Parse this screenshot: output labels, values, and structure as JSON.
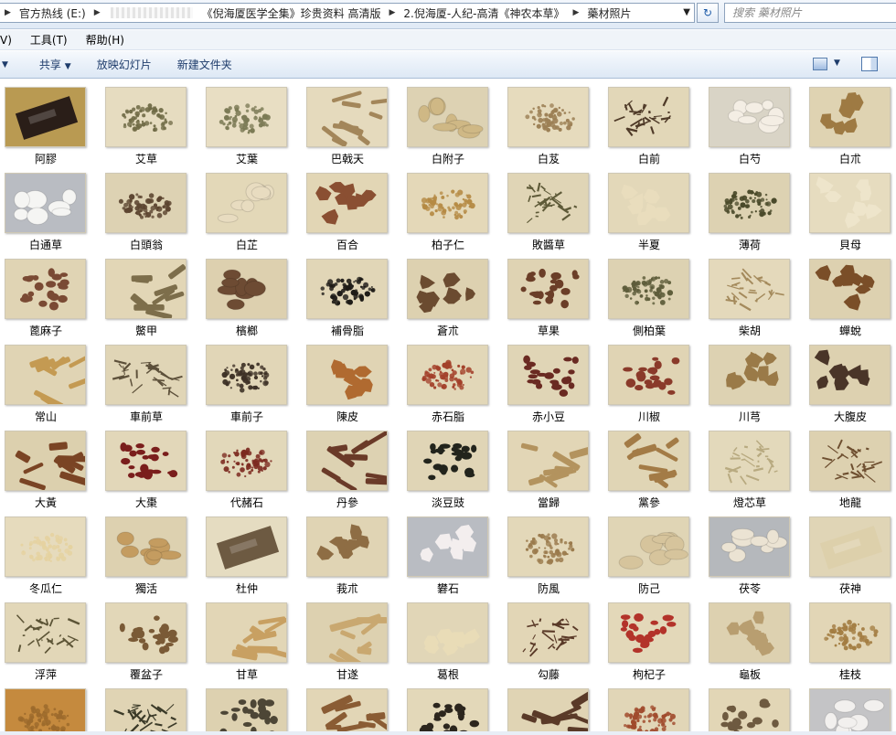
{
  "address": {
    "crumbs": [
      "官方热线 (E:)",
      "《倪海厦医学全集》珍贵资料 高清版",
      "2.倪海厦-人纪-高清《神农本草》",
      "藥材照片"
    ],
    "refresh_icon": "refresh-icon",
    "search_placeholder": "搜索 藥材照片"
  },
  "menu": {
    "items": [
      "V)",
      "工具(T)",
      "帮助(H)"
    ]
  },
  "commands": {
    "share": "共享",
    "slideshow": "放映幻灯片",
    "new_folder": "新建文件夹"
  },
  "folder": {
    "items": [
      {
        "name": "阿膠",
        "bg": "#b99a52",
        "fg": "#2a1e18",
        "style": "block"
      },
      {
        "name": "艾草",
        "bg": "#e6dcc0",
        "fg": "#6f6a45",
        "style": "pile"
      },
      {
        "name": "艾葉",
        "bg": "#e8dec3",
        "fg": "#7b7a55",
        "style": "pile"
      },
      {
        "name": "巴戟天",
        "bg": "#e5dabd",
        "fg": "#a3865a",
        "style": "sticks"
      },
      {
        "name": "白附子",
        "bg": "#ddd2b3",
        "fg": "#cfb885",
        "style": "slices"
      },
      {
        "name": "白芨",
        "bg": "#e6dbbd",
        "fg": "#9c8055",
        "style": "pile"
      },
      {
        "name": "白前",
        "bg": "#e2d7b8",
        "fg": "#4f3a28",
        "style": "fibers"
      },
      {
        "name": "白芍",
        "bg": "#d9d4c6",
        "fg": "#f4eee4",
        "style": "slices"
      },
      {
        "name": "白朮",
        "bg": "#dfd3b2",
        "fg": "#9e7a43",
        "style": "chunks"
      },
      {
        "name": "白通草",
        "bg": "#b9bcc2",
        "fg": "#f5f5f3",
        "style": "slices"
      },
      {
        "name": "白頭翁",
        "bg": "#ddd2b3",
        "fg": "#5c4530",
        "style": "pile"
      },
      {
        "name": "白芷",
        "bg": "#e3d8b8",
        "fg": "#e8dcc0",
        "style": "slices"
      },
      {
        "name": "百合",
        "bg": "#e2d6b5",
        "fg": "#8a4f32",
        "style": "chunks"
      },
      {
        "name": "柏子仁",
        "bg": "#e4d8b8",
        "fg": "#b58a44",
        "style": "pile"
      },
      {
        "name": "敗醬草",
        "bg": "#e0d5b6",
        "fg": "#5e5a38",
        "style": "fibers"
      },
      {
        "name": "半夏",
        "bg": "#e3d8b9",
        "fg": "#e9ddbd",
        "style": "chunks"
      },
      {
        "name": "薄荷",
        "bg": "#ddd2b2",
        "fg": "#4a4a2a",
        "style": "pile"
      },
      {
        "name": "貝母",
        "bg": "#e6dcbf",
        "fg": "#eee5cb",
        "style": "chunks"
      },
      {
        "name": "蓖麻子",
        "bg": "#e0d4b4",
        "fg": "#7a4a34",
        "style": "seeds"
      },
      {
        "name": "鱉甲",
        "bg": "#e2d6b6",
        "fg": "#7d6e4b",
        "style": "sticks"
      },
      {
        "name": "檳榔",
        "bg": "#ddd0af",
        "fg": "#6d4b33",
        "style": "slices"
      },
      {
        "name": "補骨脂",
        "bg": "#e1d6b7",
        "fg": "#1d1a16",
        "style": "pile"
      },
      {
        "name": "蒼朮",
        "bg": "#ddd1b0",
        "fg": "#6b4b30",
        "style": "chunks"
      },
      {
        "name": "草果",
        "bg": "#dfd3b3",
        "fg": "#6b3e28",
        "style": "seeds"
      },
      {
        "name": "側柏葉",
        "bg": "#ddd2b2",
        "fg": "#5d5c3a",
        "style": "pile"
      },
      {
        "name": "柴胡",
        "bg": "#e4d9bb",
        "fg": "#a48a5c",
        "style": "fibers"
      },
      {
        "name": "蟬蛻",
        "bg": "#ddd1b0",
        "fg": "#7a4e28",
        "style": "chunks"
      },
      {
        "name": "常山",
        "bg": "#e0d4b4",
        "fg": "#c49a52",
        "style": "sticks"
      },
      {
        "name": "車前草",
        "bg": "#e0d5b6",
        "fg": "#5d503a",
        "style": "fibers"
      },
      {
        "name": "車前子",
        "bg": "#e1d6b7",
        "fg": "#3d3126",
        "style": "pile"
      },
      {
        "name": "陳皮",
        "bg": "#e0d4b4",
        "fg": "#b06a30",
        "style": "chunks"
      },
      {
        "name": "赤石脂",
        "bg": "#e2d7b8",
        "fg": "#a3402a",
        "style": "pile"
      },
      {
        "name": "赤小豆",
        "bg": "#e0d5b6",
        "fg": "#6a2a22",
        "style": "seeds"
      },
      {
        "name": "川椒",
        "bg": "#e0d4b4",
        "fg": "#8a3a2a",
        "style": "seeds"
      },
      {
        "name": "川芎",
        "bg": "#ddd2b2",
        "fg": "#9a7a48",
        "style": "chunks"
      },
      {
        "name": "大腹皮",
        "bg": "#ddd1b0",
        "fg": "#4a3528",
        "style": "chunks"
      },
      {
        "name": "大黃",
        "bg": "#dcd0ae",
        "fg": "#7a4424",
        "style": "sticks"
      },
      {
        "name": "大棗",
        "bg": "#e2d7b9",
        "fg": "#7a1e1c",
        "style": "seeds"
      },
      {
        "name": "代赭石",
        "bg": "#e2d8ba",
        "fg": "#7c2a20",
        "style": "pile"
      },
      {
        "name": "丹參",
        "bg": "#ddd2b2",
        "fg": "#6a3a28",
        "style": "sticks"
      },
      {
        "name": "淡豆豉",
        "bg": "#e0d5b6",
        "fg": "#22241c",
        "style": "seeds"
      },
      {
        "name": "當歸",
        "bg": "#e2d6b6",
        "fg": "#b3935e",
        "style": "sticks"
      },
      {
        "name": "黨參",
        "bg": "#e0d5b5",
        "fg": "#a37b46",
        "style": "sticks"
      },
      {
        "name": "燈芯草",
        "bg": "#e3d9bb",
        "fg": "#b8aa80",
        "style": "fibers"
      },
      {
        "name": "地龍",
        "bg": "#ddd1b0",
        "fg": "#6e4f30",
        "style": "fibers"
      },
      {
        "name": "冬瓜仁",
        "bg": "#e6dbbd",
        "fg": "#e5d2a0",
        "style": "pile"
      },
      {
        "name": "獨活",
        "bg": "#ddd1b0",
        "fg": "#c49c60",
        "style": "slices"
      },
      {
        "name": "杜仲",
        "bg": "#e5dcc1",
        "fg": "#6d5a42",
        "style": "block"
      },
      {
        "name": "莪朮",
        "bg": "#e0d4b4",
        "fg": "#8e6d44",
        "style": "chunks"
      },
      {
        "name": "礬石",
        "bg": "#b9bcc2",
        "fg": "#f3eeee",
        "style": "chunks"
      },
      {
        "name": "防風",
        "bg": "#e3d8b9",
        "fg": "#9a7a4c",
        "style": "pile"
      },
      {
        "name": "防己",
        "bg": "#e0d5b5",
        "fg": "#d6c49c",
        "style": "slices"
      },
      {
        "name": "茯苓",
        "bg": "#b5b8bc",
        "fg": "#ebe3d3",
        "style": "slices"
      },
      {
        "name": "茯神",
        "bg": "#e0d5b6",
        "fg": "#ddd0ab",
        "style": "block"
      },
      {
        "name": "浮萍",
        "bg": "#e2d7b8",
        "fg": "#5c5436",
        "style": "fibers"
      },
      {
        "name": "覆盆子",
        "bg": "#e2d7b8",
        "fg": "#7a5a36",
        "style": "seeds"
      },
      {
        "name": "甘草",
        "bg": "#e2d6b6",
        "fg": "#c8a062",
        "style": "sticks"
      },
      {
        "name": "甘遂",
        "bg": "#ddd1b0",
        "fg": "#c9a870",
        "style": "sticks"
      },
      {
        "name": "葛根",
        "bg": "#e1d6b7",
        "fg": "#e9dcb7",
        "style": "chunks"
      },
      {
        "name": "勾藤",
        "bg": "#e2d6b6",
        "fg": "#5a3a28",
        "style": "fibers"
      },
      {
        "name": "枸杞子",
        "bg": "#e3d8b9",
        "fg": "#b3332a",
        "style": "seeds"
      },
      {
        "name": "龜板",
        "bg": "#ddd1b0",
        "fg": "#b89e70",
        "style": "chunks"
      },
      {
        "name": "桂枝",
        "bg": "#e2d6b6",
        "fg": "#a37d42",
        "style": "pile"
      },
      {
        "name": "",
        "bg": "#c58a3e",
        "fg": "#9c6a2c",
        "style": "pile"
      },
      {
        "name": "",
        "bg": "#e0d4b4",
        "fg": "#3b3a28",
        "style": "fibers"
      },
      {
        "name": "",
        "bg": "#ddd1b0",
        "fg": "#4d4636",
        "style": "seeds"
      },
      {
        "name": "",
        "bg": "#e2d6b6",
        "fg": "#8a5c34",
        "style": "sticks"
      },
      {
        "name": "",
        "bg": "#e3d8b9",
        "fg": "#2c261e",
        "style": "seeds"
      },
      {
        "name": "",
        "bg": "#e0d4b4",
        "fg": "#5a3a28",
        "style": "sticks"
      },
      {
        "name": "",
        "bg": "#e1d6b7",
        "fg": "#a04a2c",
        "style": "pile"
      },
      {
        "name": "",
        "bg": "#e2d6b6",
        "fg": "#6e5a40",
        "style": "seeds"
      },
      {
        "name": "",
        "bg": "#c4c4c6",
        "fg": "#f2f0ee",
        "style": "slices"
      }
    ]
  }
}
